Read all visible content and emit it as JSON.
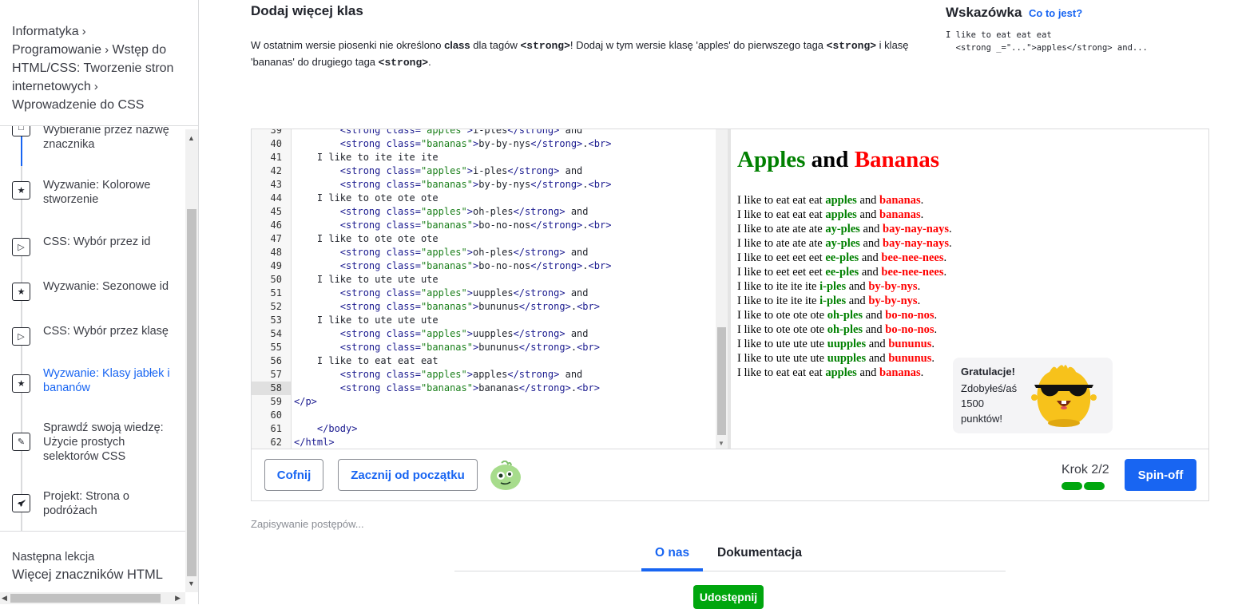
{
  "breadcrumbs": [
    "Informatyka",
    "Programowanie",
    "Wstęp do HTML/CSS: Tworzenie stron internetowych",
    "Wprowadzenie do CSS"
  ],
  "breadcrumb_sep": "›",
  "lessons": [
    {
      "label": "Wybieranie przez nazwę znacznika",
      "icon": "□"
    },
    {
      "label": "Wyzwanie: Kolorowe stworzenie",
      "icon": "★"
    },
    {
      "label": "CSS: Wybór przez id",
      "icon": "▷"
    },
    {
      "label": "Wyzwanie: Sezonowe id",
      "icon": "★"
    },
    {
      "label": "CSS: Wybór przez klasę",
      "icon": "▷"
    },
    {
      "label": "Wyzwanie: Klasy jabłek i bananów",
      "icon": "★"
    },
    {
      "label": "Sprawdź swoją wiedzę: Użycie prostych selektorów CSS",
      "icon": "✎"
    },
    {
      "label": "Projekt: Strona o podróżach",
      "icon": "🚀"
    }
  ],
  "next": {
    "label": "Następna lekcja",
    "title": "Więcej znaczników HTML"
  },
  "task": {
    "title": "Dodaj więcej klas",
    "desc_1": "W ostatnim wersie piosenki nie określono ",
    "desc_class": "class",
    "desc_2": " dla tagów ",
    "desc_tag1": "<strong>",
    "desc_3": "! Dodaj w tym wersie klasę 'apples' do pierwszego taga ",
    "desc_tag2": "<strong>",
    "desc_4": " i klasę 'bananas' do drugiego taga ",
    "desc_tag3": "<strong>",
    "desc_5": "."
  },
  "hint": {
    "title": "Wskazówka",
    "link": "Co to jest?",
    "code": "I like to eat eat eat\n  <strong _=\"...\">apples</strong> and..."
  },
  "editor": {
    "line_numbers": [
      "39",
      "40",
      "41",
      "42",
      "43",
      "44",
      "45",
      "46",
      "47",
      "48",
      "49",
      "50",
      "51",
      "52",
      "53",
      "54",
      "55",
      "56",
      "57",
      "58",
      "59",
      "60",
      "61",
      "62"
    ],
    "highlight_line": "58"
  },
  "preview": {
    "title_apples": "Apples",
    "title_and": " and ",
    "title_bananas": "Bananas",
    "lines": [
      {
        "pre": "I like to eat eat eat ",
        "a": "apples",
        "mid": " and ",
        "b": "bananas",
        "end": "."
      },
      {
        "pre": "I like to eat eat eat ",
        "a": "apples",
        "mid": " and ",
        "b": "bananas",
        "end": "."
      },
      {
        "pre": "I like to ate ate ate ",
        "a": "ay-ples",
        "mid": " and ",
        "b": "bay-nay-nays",
        "end": "."
      },
      {
        "pre": "I like to ate ate ate ",
        "a": "ay-ples",
        "mid": " and ",
        "b": "bay-nay-nays",
        "end": "."
      },
      {
        "pre": "I like to eet eet eet ",
        "a": "ee-ples",
        "mid": " and ",
        "b": "bee-nee-nees",
        "end": "."
      },
      {
        "pre": "I like to eet eet eet ",
        "a": "ee-ples",
        "mid": " and ",
        "b": "bee-nee-nees",
        "end": "."
      },
      {
        "pre": "I like to ite ite ite ",
        "a": "i-ples",
        "mid": " and ",
        "b": "by-by-nys",
        "end": "."
      },
      {
        "pre": "I like to ite ite ite ",
        "a": "i-ples",
        "mid": " and ",
        "b": "by-by-nys",
        "end": "."
      },
      {
        "pre": "I like to ote ote ote ",
        "a": "oh-ples",
        "mid": " and ",
        "b": "bo-no-nos",
        "end": "."
      },
      {
        "pre": "I like to ote ote ote ",
        "a": "oh-ples",
        "mid": " and ",
        "b": "bo-no-nos",
        "end": "."
      },
      {
        "pre": "I like to ute ute ute ",
        "a": "uupples",
        "mid": " and ",
        "b": "bununus",
        "end": "."
      },
      {
        "pre": "I like to ute ute ute ",
        "a": "uupples",
        "mid": " and ",
        "b": "bununus",
        "end": "."
      },
      {
        "pre": "I like to eat eat eat ",
        "a": "apples",
        "mid": " and ",
        "b": "bananas",
        "end": "."
      }
    ],
    "toast_title": "Gratulacje!",
    "toast_text": "Zdobyłeś/aś 1500 punktów!"
  },
  "footer": {
    "undo": "Cofnij",
    "restart": "Zacznij od początku",
    "step": "Krok 2/2",
    "step_progress": 1.0,
    "spinoff": "Spin-off"
  },
  "saving": "Zapisywanie postępów...",
  "tabs": [
    "O nas",
    "Dokumentacja"
  ],
  "share": "Udostępnij",
  "colors": {
    "accent": "#1865f2",
    "success": "#00a60e",
    "apples": "#008000",
    "bananas": "#ff0000"
  }
}
